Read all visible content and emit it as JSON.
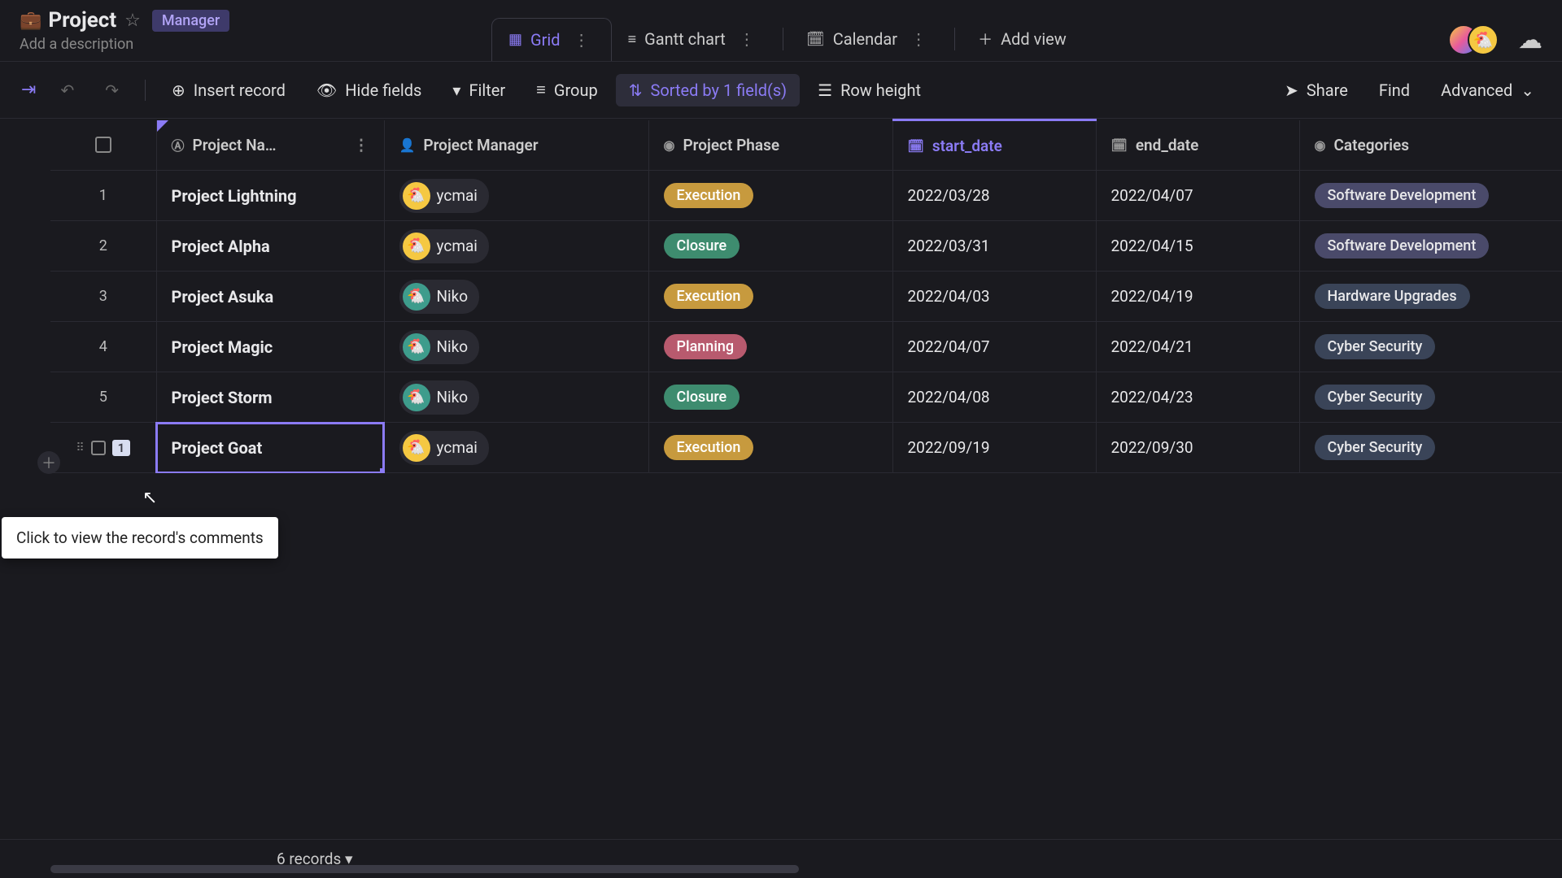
{
  "header": {
    "icon": "💼",
    "title": "Project",
    "badge": "Manager",
    "description_placeholder": "Add a description"
  },
  "tabs": [
    {
      "icon": "grid",
      "label": "Grid",
      "active": true
    },
    {
      "icon": "gantt",
      "label": "Gantt chart",
      "active": false
    },
    {
      "icon": "calendar",
      "label": "Calendar",
      "active": false
    },
    {
      "icon": "plus",
      "label": "Add view",
      "active": false
    }
  ],
  "toolbar": {
    "insert": "Insert record",
    "hide": "Hide fields",
    "filter": "Filter",
    "group": "Group",
    "sorted": "Sorted by 1 field(s)",
    "row_height": "Row height",
    "share": "Share",
    "find": "Find",
    "advanced": "Advanced"
  },
  "columns": {
    "name": "Project Na…",
    "manager": "Project Manager",
    "phase": "Project Phase",
    "start": "start_date",
    "end": "end_date",
    "categories": "Categories"
  },
  "rows": [
    {
      "num": "1",
      "name": "Project Lightning",
      "manager": "ycmai",
      "mgr_color": "#f5c842",
      "phase": "Execution",
      "phase_bg": "#c79a3e",
      "start": "2022/03/28",
      "end": "2022/04/07",
      "cat": "Software Development",
      "cat_bg": "#4a4a6a"
    },
    {
      "num": "2",
      "name": "Project Alpha",
      "manager": "ycmai",
      "mgr_color": "#f5c842",
      "phase": "Closure",
      "phase_bg": "#3e8c6f",
      "start": "2022/03/31",
      "end": "2022/04/15",
      "cat": "Software Development",
      "cat_bg": "#4a4a6a"
    },
    {
      "num": "3",
      "name": "Project Asuka",
      "manager": "Niko",
      "mgr_color": "#3e9c8c",
      "phase": "Execution",
      "phase_bg": "#c79a3e",
      "start": "2022/04/03",
      "end": "2022/04/19",
      "cat": "Hardware Upgrades",
      "cat_bg": "#3a4458"
    },
    {
      "num": "4",
      "name": "Project Magic",
      "manager": "Niko",
      "mgr_color": "#3e9c8c",
      "phase": "Planning",
      "phase_bg": "#b85a6e",
      "start": "2022/04/07",
      "end": "2022/04/21",
      "cat": "Cyber Security",
      "cat_bg": "#3a4458"
    },
    {
      "num": "5",
      "name": "Project Storm",
      "manager": "Niko",
      "mgr_color": "#3e9c8c",
      "phase": "Closure",
      "phase_bg": "#3e8c6f",
      "start": "2022/04/08",
      "end": "2022/04/23",
      "cat": "Cyber Security",
      "cat_bg": "#3a4458"
    },
    {
      "num": "",
      "name": "Project Goat",
      "manager": "ycmai",
      "mgr_color": "#f5c842",
      "phase": "Execution",
      "phase_bg": "#c79a3e",
      "start": "2022/09/19",
      "end": "2022/09/30",
      "cat": "Cyber Security",
      "cat_bg": "#3a4458",
      "selected": true,
      "comment_count": "1"
    }
  ],
  "tooltip": "Click to view the record's comments",
  "footer": {
    "count": "6 records ▾"
  }
}
